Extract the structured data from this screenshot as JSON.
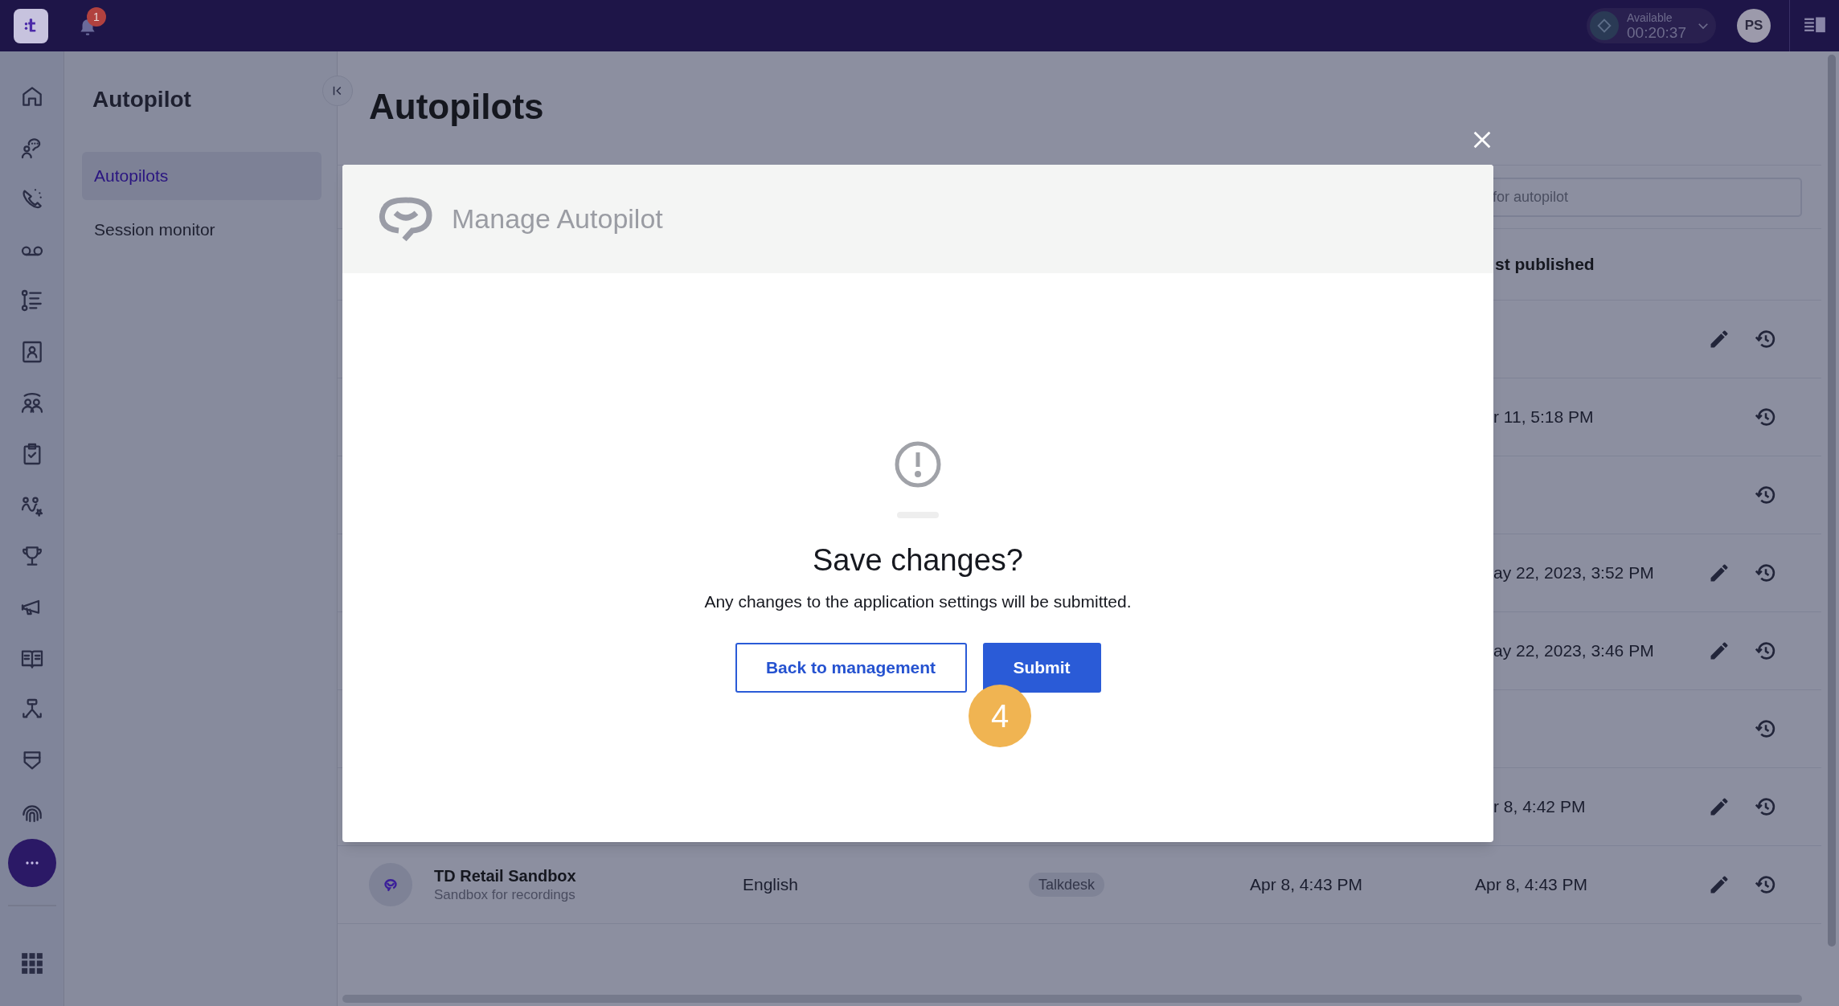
{
  "top_bar": {
    "notification_count": "1",
    "status": {
      "label": "Available",
      "timer": "00:20:37"
    },
    "avatar": "PS"
  },
  "sidebar": {
    "title": "Autopilot",
    "items": [
      {
        "label": "Autopilots",
        "selected": true
      },
      {
        "label": "Session monitor",
        "selected": false
      }
    ]
  },
  "page": {
    "title": "Autopilots",
    "search": {
      "placeholder": "for autopilot"
    }
  },
  "table": {
    "columns": [
      {
        "label": "st published"
      }
    ],
    "rows": [
      {
        "editable": true
      },
      {
        "last_published": "r 11, 5:18 PM",
        "editable": false
      },
      {
        "editable": false
      },
      {
        "last_published": "ay 22, 2023, 3:52 PM",
        "editable": true
      },
      {
        "last_published": "ay 22, 2023, 3:46 PM",
        "editable": true
      },
      {
        "editable": false
      },
      {
        "last_published": "r 8, 4:42 PM",
        "editable": true
      },
      {
        "name": "TD Retail Sandbox",
        "description": "Sandbox for recordings",
        "language": "English",
        "tag": "Talkdesk",
        "created": "Apr 8, 4:43 PM",
        "last_published": "Apr 8, 4:43 PM",
        "editable": true
      }
    ]
  },
  "modal": {
    "title": "Manage Autopilot",
    "heading": "Save changes?",
    "message": "Any changes to the application settings will be submitted.",
    "buttons": [
      {
        "label": "Back to management",
        "kind": "secondary"
      },
      {
        "label": "Submit",
        "kind": "primary"
      }
    ]
  },
  "step_badge": "4"
}
